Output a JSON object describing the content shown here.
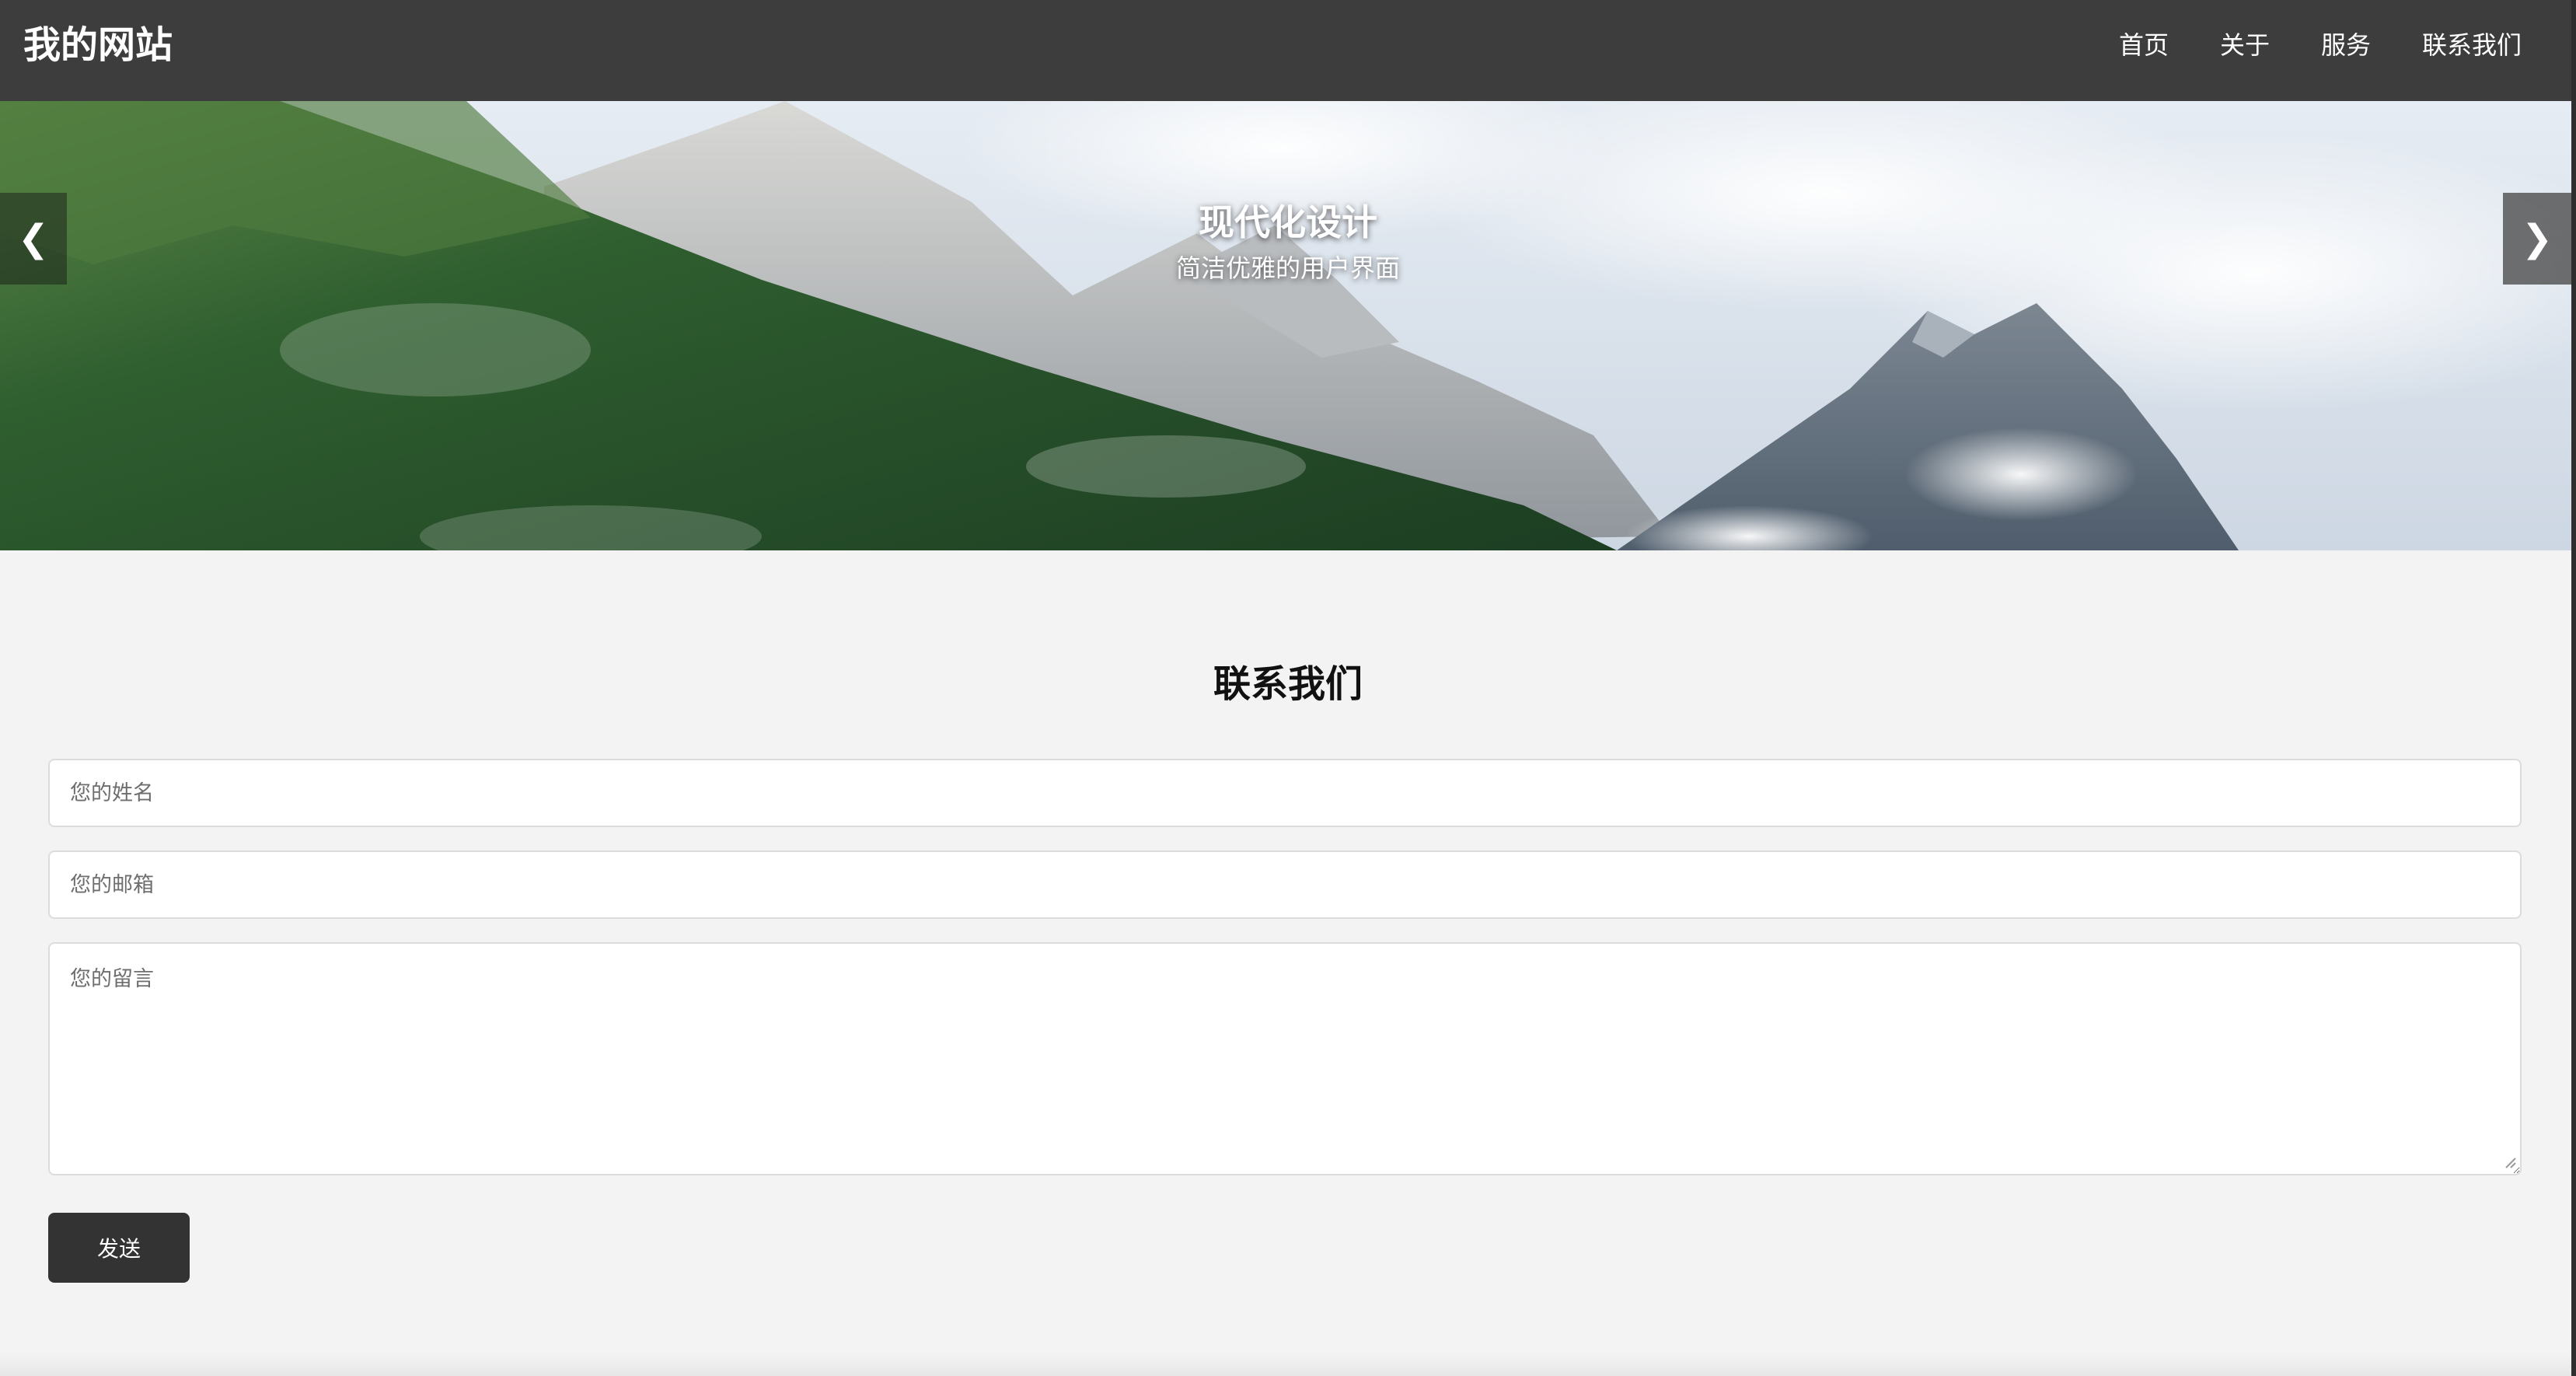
{
  "header": {
    "logo": "我的网站",
    "nav": [
      {
        "label": "首页"
      },
      {
        "label": "关于"
      },
      {
        "label": "服务"
      },
      {
        "label": "联系我们"
      }
    ]
  },
  "hero": {
    "title": "现代化设计",
    "subtitle": "简洁优雅的用户界面",
    "prev_glyph": "❮",
    "next_glyph": "❯",
    "prev_icon": "chevron-left-icon",
    "next_icon": "chevron-right-icon"
  },
  "contact": {
    "title": "联系我们",
    "name_placeholder": "您的姓名",
    "email_placeholder": "您的邮箱",
    "message_placeholder": "您的留言",
    "send_label": "发送"
  },
  "colors": {
    "header_bg": "#3d3d3d",
    "page_bg": "#f3f3f3",
    "button_bg": "#333333"
  }
}
